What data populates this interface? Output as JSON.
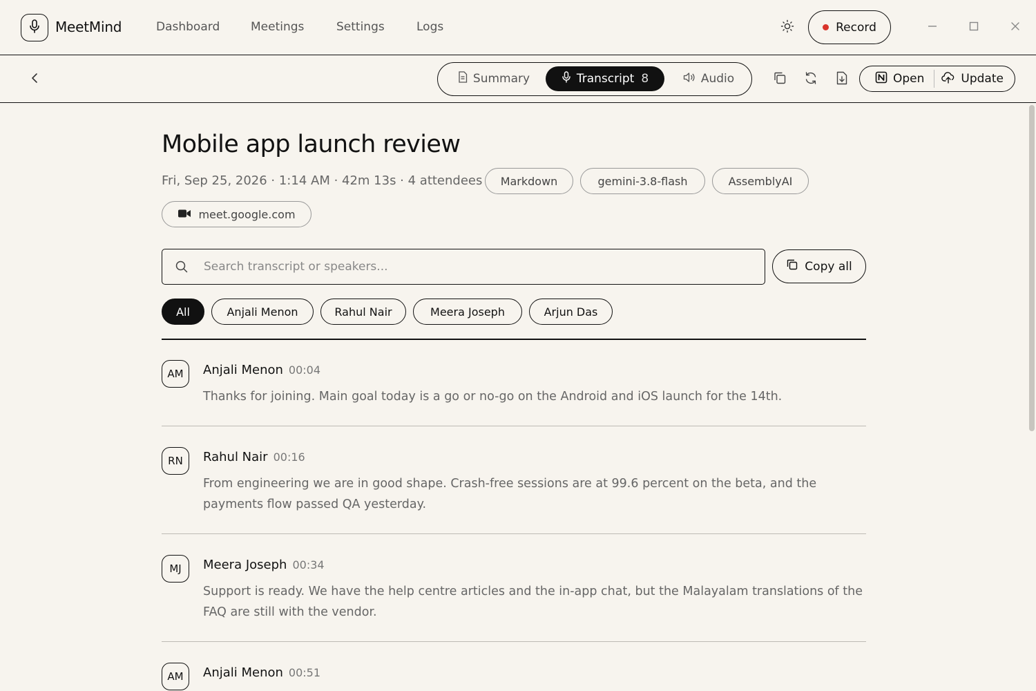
{
  "app": {
    "name": "MeetMind"
  },
  "nav": {
    "items": [
      {
        "label": "Dashboard"
      },
      {
        "label": "Meetings"
      },
      {
        "label": "Settings"
      },
      {
        "label": "Logs"
      }
    ]
  },
  "header": {
    "record_label": "Record",
    "record_dot_color": "#d9342b",
    "icons": [
      "mic-icon",
      "sun-icon",
      "minimize-icon",
      "maximize-icon",
      "close-icon"
    ]
  },
  "toolbar": {
    "tabs": [
      {
        "label": "Summary",
        "icon": "document-icon",
        "active": false
      },
      {
        "label": "Transcript",
        "icon": "mic-icon",
        "active": true,
        "count": "8"
      },
      {
        "label": "Audio",
        "icon": "speaker-icon",
        "active": false
      }
    ],
    "tool_icons": [
      "copy-icon",
      "refresh-icon",
      "export-icon"
    ],
    "open_label": "Open",
    "update_label": "Update"
  },
  "meeting": {
    "title": "Mobile app launch review",
    "meta": "Fri, Sep 25, 2026 · 1:14 AM · 42m 13s · 4 attendees",
    "chips": [
      "Markdown",
      "gemini-3.8-flash",
      "AssemblyAI"
    ],
    "link": "meet.google.com"
  },
  "transcript": {
    "search_placeholder": "Search transcript or speakers...",
    "copy_all_label": "Copy all",
    "filters": [
      "All",
      "Anjali Menon",
      "Rahul Nair",
      "Meera Joseph",
      "Arjun Das"
    ],
    "active_filter": "All",
    "entries": [
      {
        "initials": "AM",
        "speaker": "Anjali Menon",
        "time": "00:04",
        "text": "Thanks for joining. Main goal today is a go or no-go on the Android and iOS launch for the 14th."
      },
      {
        "initials": "RN",
        "speaker": "Rahul Nair",
        "time": "00:16",
        "text": "From engineering we are in good shape. Crash-free sessions are at 99.6 percent on the beta, and the payments flow passed QA yesterday."
      },
      {
        "initials": "MJ",
        "speaker": "Meera Joseph",
        "time": "00:34",
        "text": "Support is ready. We have the help centre articles and the in-app chat, but the Malayalam translations of the FAQ are still with the vendor."
      },
      {
        "initials": "AM",
        "speaker": "Anjali Menon",
        "time": "00:51",
        "text": ""
      }
    ]
  },
  "colors": {
    "background": "#f7f4ee",
    "ink": "#111111",
    "muted": "#666666"
  }
}
